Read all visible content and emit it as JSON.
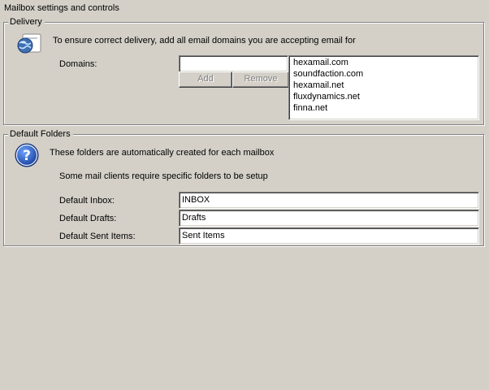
{
  "page": {
    "title": "Mailbox settings and controls"
  },
  "delivery": {
    "legend": "Delivery",
    "description": "To ensure correct delivery, add all email domains you are accepting email for",
    "domains_label": "Domains:",
    "domain_input_value": "",
    "add_label": "Add",
    "remove_label": "Remove",
    "domains": [
      "hexamail.com",
      "soundfaction.com",
      "hexamail.net",
      "fluxdynamics.net",
      "finna.net"
    ]
  },
  "default_folders": {
    "legend": "Default Folders",
    "description": "These folders are automatically created for each mailbox",
    "note": "Some mail clients require specific folders to be setup",
    "inbox_label": "Default Inbox:",
    "inbox_value": "INBOX",
    "drafts_label": "Default Drafts:",
    "drafts_value": "Drafts",
    "sent_label": "Default Sent Items:",
    "sent_value": "Sent Items"
  },
  "colors": {
    "background": "#d4d0c8",
    "disabled_text": "#808080"
  },
  "icons": {
    "delivery": "mail-globe-icon",
    "folders": "help-icon"
  }
}
